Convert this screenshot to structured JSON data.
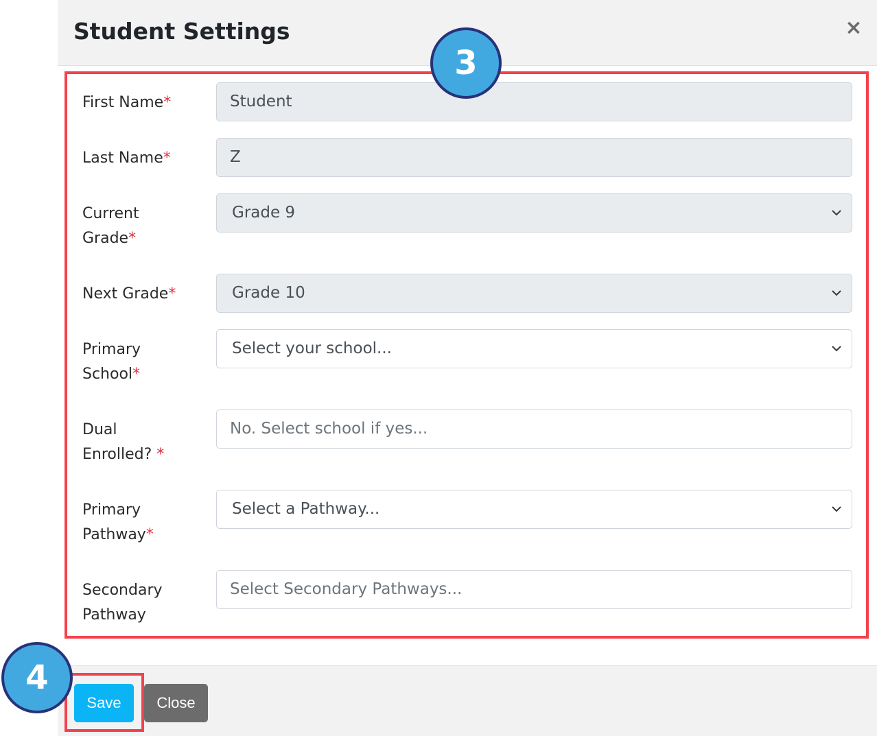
{
  "modal": {
    "title": "Student Settings",
    "close_icon": "×"
  },
  "form": {
    "first_name": {
      "label": "First Name",
      "required_mark": "*",
      "value": "Student"
    },
    "last_name": {
      "label": "Last Name",
      "required_mark": "*",
      "value": "Z"
    },
    "current_grade": {
      "label_line1": "Current",
      "label_line2": "Grade",
      "required_mark": "*",
      "value": "Grade 9"
    },
    "next_grade": {
      "label": "Next Grade",
      "required_mark": "*",
      "value": "Grade 10"
    },
    "primary_school": {
      "label_line1": "Primary",
      "label_line2": "School",
      "required_mark": "*",
      "placeholder": "Select your school..."
    },
    "dual_enrolled": {
      "label_line1": "Dual",
      "label_line2": "Enrolled? ",
      "required_mark": "*",
      "placeholder": "No. Select school if yes..."
    },
    "primary_pathway": {
      "label_line1": "Primary",
      "label_line2": "Pathway",
      "required_mark": "*",
      "placeholder": "Select a Pathway..."
    },
    "secondary_pathway": {
      "label_line1": "Secondary",
      "label_line2": "Pathway",
      "placeholder": "Select Secondary Pathways..."
    }
  },
  "footer": {
    "save_label": "Save",
    "close_label": "Close"
  },
  "callouts": {
    "step3": "3",
    "step4": "4"
  },
  "colors": {
    "highlight": "#f2424d",
    "badge_fill": "#42a9e0",
    "badge_border": "#26337a",
    "save_button": "#0ab4f5",
    "close_button": "#6c6c6c",
    "required": "#e0303a"
  }
}
